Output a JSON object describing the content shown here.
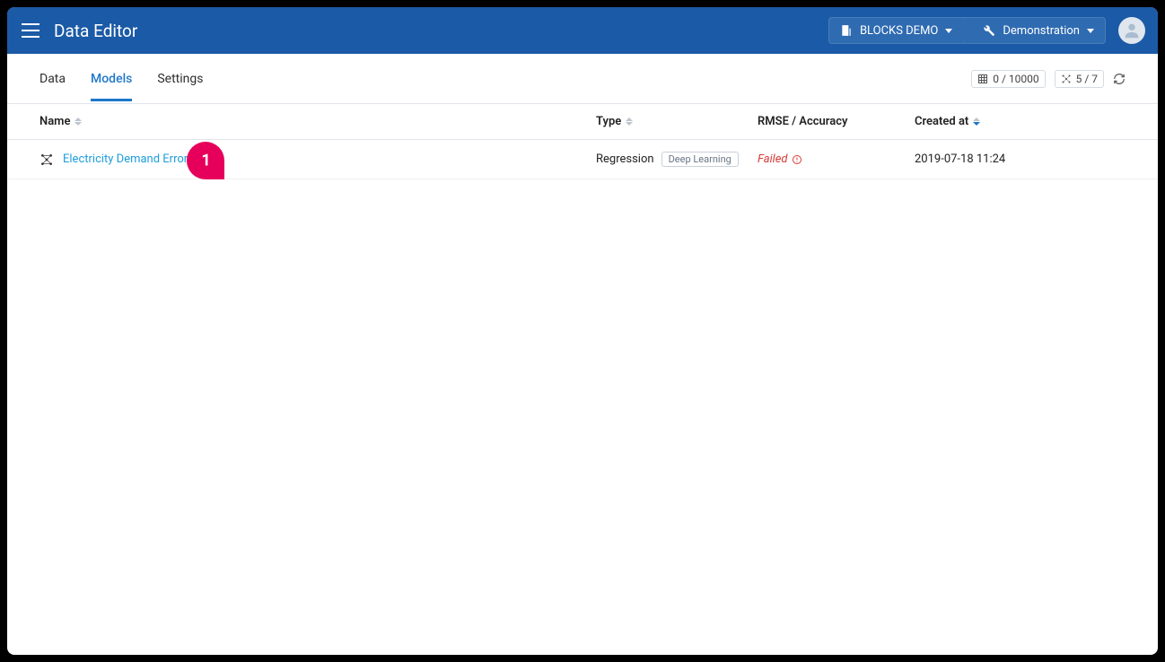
{
  "header": {
    "title": "Data Editor",
    "breadcrumb1": "BLOCKS DEMO",
    "breadcrumb2": "Demonstration"
  },
  "tabs": {
    "data": "Data",
    "models": "Models",
    "settings": "Settings"
  },
  "stats": {
    "rows": "0 / 10000",
    "fields": "5 / 7"
  },
  "columns": {
    "name": "Name",
    "type": "Type",
    "rmse": "RMSE / Accuracy",
    "created": "Created at"
  },
  "row": {
    "name": "Electricity Demand Error",
    "type": "Regression",
    "type_badge": "Deep Learning",
    "status": "Failed",
    "created": "2019-07-18 11:24"
  },
  "callout": "1"
}
